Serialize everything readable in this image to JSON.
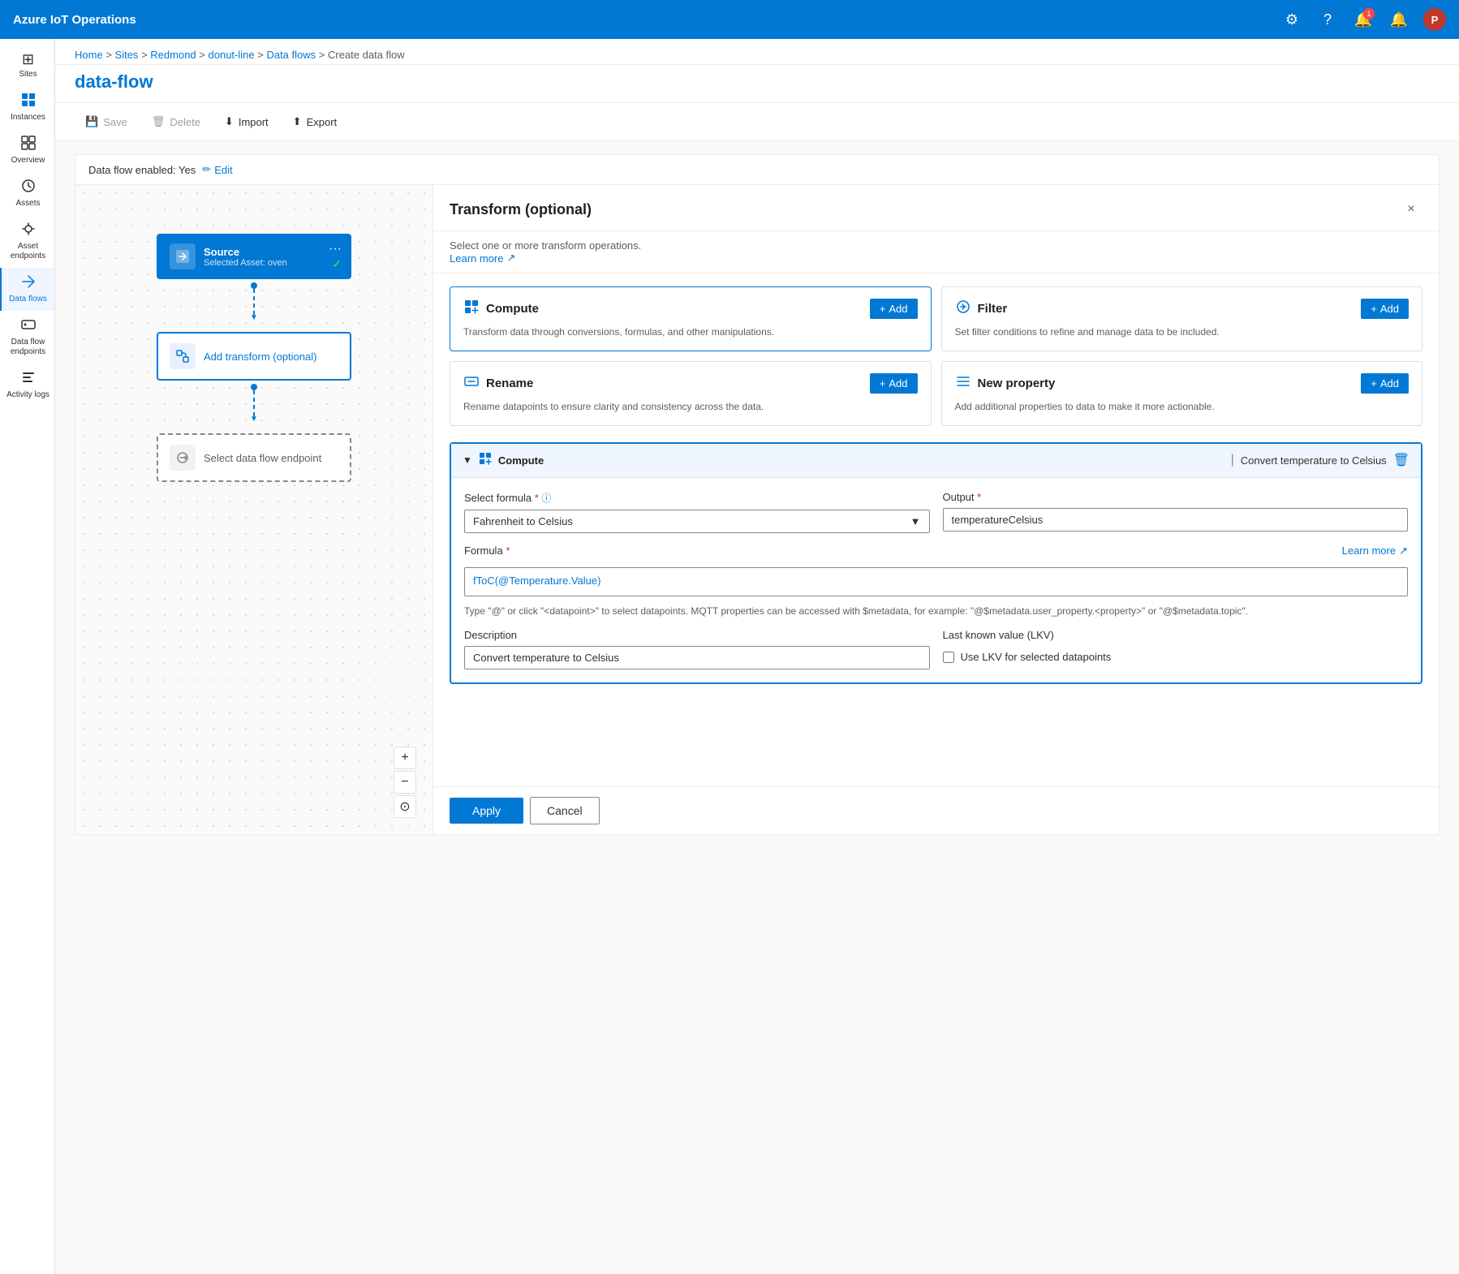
{
  "app": {
    "title": "Azure IoT Operations"
  },
  "topnav": {
    "title": "Azure IoT Operations",
    "notification_count": "1",
    "avatar_label": "P"
  },
  "breadcrumb": {
    "items": [
      "Home",
      "Sites",
      "Redmond",
      "donut-line",
      "Data flows",
      "Create data flow"
    ]
  },
  "page": {
    "title": "data-flow"
  },
  "toolbar": {
    "save_label": "Save",
    "delete_label": "Delete",
    "import_label": "Import",
    "export_label": "Export"
  },
  "dataflow": {
    "enabled_label": "Data flow enabled: Yes",
    "edit_label": "Edit"
  },
  "sidebar": {
    "items": [
      {
        "id": "sites",
        "label": "Sites",
        "icon": "⊞"
      },
      {
        "id": "instances",
        "label": "Instances",
        "icon": "⬛"
      },
      {
        "id": "overview",
        "label": "Overview",
        "icon": "⊡"
      },
      {
        "id": "assets",
        "label": "Assets",
        "icon": "◈"
      },
      {
        "id": "asset-endpoints",
        "label": "Asset endpoints",
        "icon": "⊛"
      },
      {
        "id": "data-flows",
        "label": "Data flows",
        "icon": "⇌"
      },
      {
        "id": "data-flow-endpoints",
        "label": "Data flow endpoints",
        "icon": "⊕"
      },
      {
        "id": "activity-logs",
        "label": "Activity logs",
        "icon": "≡"
      }
    ]
  },
  "flow": {
    "source_title": "Source",
    "source_subtitle": "Selected Asset: oven",
    "transform_label": "Add transform (optional)",
    "endpoint_label": "Select data flow endpoint"
  },
  "transform_panel": {
    "title": "Transform (optional)",
    "subtitle": "Select one or more transform operations.",
    "learn_more_label": "Learn more",
    "close_label": "×",
    "cards": [
      {
        "id": "compute",
        "icon": "⊞",
        "title": "Compute",
        "description": "Transform data through conversions, formulas, and other manipulations.",
        "add_label": "+ Add",
        "highlighted": true
      },
      {
        "id": "filter",
        "icon": "⊜",
        "title": "Filter",
        "description": "Set filter conditions to refine and manage data to be included.",
        "add_label": "+ Add",
        "highlighted": false
      },
      {
        "id": "rename",
        "icon": "⊟",
        "title": "Rename",
        "description": "Rename datapoints to ensure clarity and consistency across the data.",
        "add_label": "+ Add",
        "highlighted": false
      },
      {
        "id": "new-property",
        "icon": "≡",
        "title": "New property",
        "description": "Add additional properties to data to make it more actionable.",
        "add_label": "+ Add",
        "highlighted": false
      }
    ],
    "compute_section": {
      "operation": "Compute",
      "separator": "|",
      "subtitle": "Convert temperature to Celsius",
      "formula_label": "Select formula",
      "formula_required": "*",
      "formula_value": "Fahrenheit to Celsius",
      "output_label": "Output",
      "output_required": "*",
      "output_value": "temperatureCelsius",
      "formula_field_label": "Formula",
      "formula_field_required": "*",
      "formula_learn_more": "Learn more",
      "formula_value_display": "fToC(@Temperature.Value)",
      "formula_hint": "Type \"@\" or click \"<datapoint>\" to select datapoints. MQTT properties can be accessed with $metadata, for example: \"@$metadata.user_property.<property>\" or \"@$metadata.topic\".",
      "description_label": "Description",
      "description_value": "Convert temperature to Celsius",
      "lkv_label": "Last known value (LKV)",
      "lkv_checkbox_label": "Use LKV for selected datapoints",
      "lkv_checked": false
    },
    "footer": {
      "apply_label": "Apply",
      "cancel_label": "Cancel"
    }
  },
  "zoom": {
    "plus": "+",
    "minus": "−",
    "reset": "⊙"
  }
}
